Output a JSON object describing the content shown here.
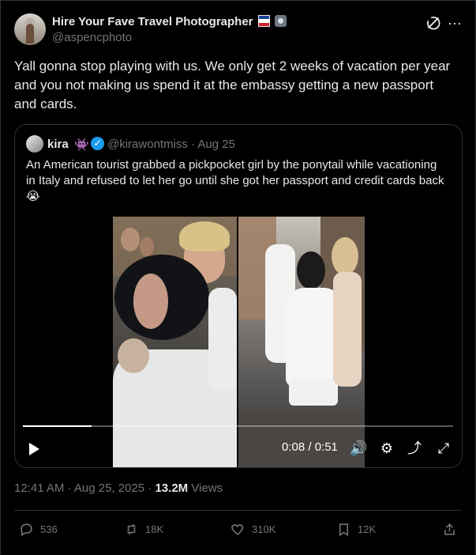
{
  "post": {
    "author_name": "Hire Your Fave Travel Photographer",
    "author_handle": "@aspencphoto",
    "text": "Yall gonna stop playing with us. We only get 2 weeks of vacation per year and you not making us spend it at the embassy getting a new passport and cards.",
    "timestamp": "12:41 AM · Aug 25, 2025 · ",
    "views_count": "13.2M",
    "views_label": " Views"
  },
  "quote": {
    "author_name": "kira",
    "alien_emoji": "👾",
    "verified_mark": "✓",
    "author_handle": "@kirawontmiss",
    "date": " · Aug 25",
    "text": "An American tourist grabbed a pickpocket girl by the ponytail while vacationing in Italy and refused to let her go until she got her passport and credit cards back😭"
  },
  "video": {
    "current_time": "0:08 / 0:51",
    "progress": 0.16
  },
  "actions": {
    "replies": "536",
    "reposts": "18K",
    "likes": "310K",
    "bookmarks": "12K"
  },
  "icons": {
    "grok": "grok-icon",
    "more": "more-icon",
    "play": "play-icon",
    "volume": "volume-icon",
    "settings": "settings-icon",
    "rotate": "rotate-icon",
    "fullscreen": "fullscreen-icon",
    "reply": "reply-icon",
    "repost": "repost-icon",
    "like": "heart-icon",
    "bookmark": "bookmark-icon",
    "share": "share-icon"
  },
  "colors": {
    "background": "#000000",
    "text": "#e7e9ea",
    "muted": "#71767b",
    "border": "#2f3336",
    "accent": "#1d9bf0"
  }
}
